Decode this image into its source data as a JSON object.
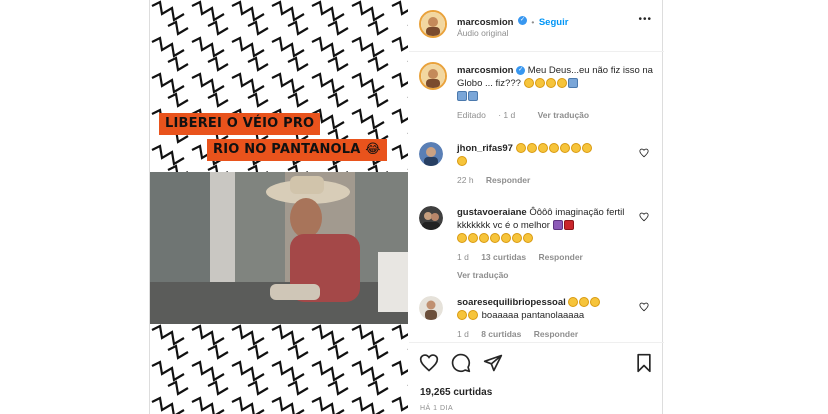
{
  "post": {
    "username": "marcosmion",
    "follow_label": "Seguir",
    "audio_label": "Áudio original",
    "more_label": "•••"
  },
  "media": {
    "caption_line1": "LIBEREI O VÉIO PRO",
    "caption_line2": "RIO NO PANTANOLA 😂"
  },
  "caption": {
    "username": "marcosmion",
    "text": "Meu Deus...eu não fiz isso na Globo ... fiz???",
    "edited": "Editado",
    "age": "1 d",
    "translate": "Ver tradução"
  },
  "comments": [
    {
      "username": "jhon_rifas97",
      "text": "",
      "age": "22 h",
      "reply": "Responder"
    },
    {
      "username": "gustavoeraiane",
      "text": "Ôôôô imaginação fertil kkkkkkk vc é o melhor",
      "age": "1 d",
      "likes": "13 curtidas",
      "reply": "Responder",
      "translate": "Ver tradução"
    },
    {
      "username": "soaresequilibriopessoal",
      "text": "boaaaaa pantanolaaaaa",
      "age": "1 d",
      "likes": "8 curtidas",
      "reply": "Responder"
    }
  ],
  "footer": {
    "likes": "19,265 curtidas",
    "time": "HÁ 1 DIA"
  },
  "colors": {
    "accent": "#0095f6",
    "caption_bg": "#e9531c",
    "verified": "#3897f0"
  }
}
